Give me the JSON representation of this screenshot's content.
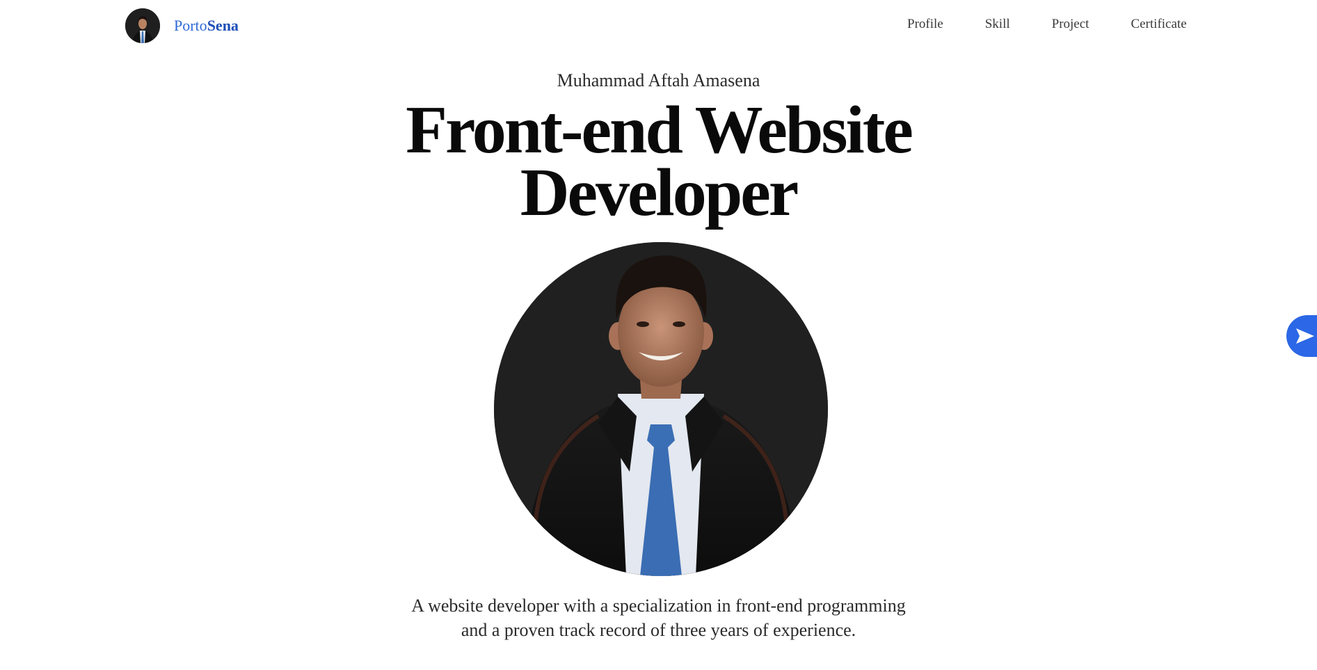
{
  "brand": {
    "name_part1": "Porto",
    "name_part2": "Sena",
    "avatar_icon": "profile-photo"
  },
  "nav": {
    "links": [
      "Profile",
      "Skill",
      "Project",
      "Certificate"
    ]
  },
  "hero": {
    "name": "Muhammad Aftah Amasena",
    "title_line1": "Front-end Website",
    "title_line2": "Developer",
    "portrait_icon": "profile-photo",
    "description_line1": "A website developer with a specialization in front-end programming",
    "description_line2": "and a proven track record of three years of experience."
  },
  "fab": {
    "icon": "send-icon"
  },
  "colors": {
    "brand": "#2f6bd8",
    "accent": "#2b67e6",
    "portrait_bg": "#202020",
    "text": "#0a0a0a"
  }
}
